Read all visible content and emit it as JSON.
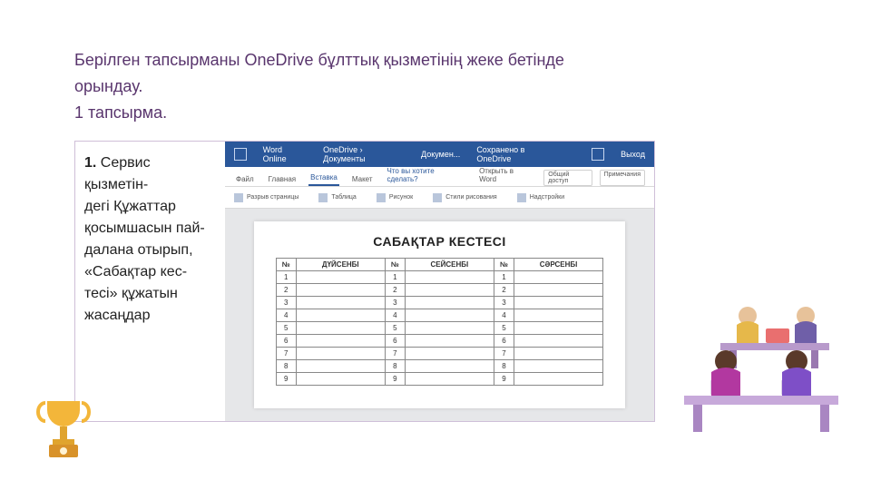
{
  "intro": {
    "line1": "Берілген тапсырманы  OneDrive бұлттық қызметінің жеке бетінде",
    "line2": "орындау.",
    "line3": "1 тапсырма."
  },
  "instruction": {
    "number": "1.",
    "text": "Сервис қызметін-\nдегі Құжаттар\nқосымшасын пай-\nдалана отырып,\n«Сабақтар кес-\nтесі» құжатын\nжасаңдар"
  },
  "word_online": {
    "app": "Word Online",
    "breadcrumb": "OneDrive › Документы",
    "docname": "Докумен...",
    "save_status": "Сохранено в OneDrive",
    "exit": "Выход",
    "tabs": {
      "file": "Файл",
      "home": "Главная",
      "insert": "Вставка",
      "layout": "Макет",
      "tell": "Что вы хотите сделать?",
      "open_word": "Открыть в Word",
      "share": "Общий доступ",
      "comments": "Примечания"
    },
    "ribbon": {
      "page_break": "Разрыв страницы",
      "table": "Таблица",
      "image": "Рисунок",
      "art": "Стили рисования",
      "addins": "Надстройки"
    }
  },
  "document": {
    "title": "САБАҚТАР КЕСТЕСІ",
    "headers": {
      "n": "№",
      "d1": "ДҮЙСЕНБІ",
      "d2": "СЕЙСЕНБІ",
      "d3": "СӘРСЕНБІ"
    },
    "rows": [
      1,
      2,
      3,
      4,
      5,
      6,
      7,
      8,
      9
    ]
  },
  "icons": {
    "trophy": "trophy-icon",
    "people": "people-collaboration-illustration"
  }
}
